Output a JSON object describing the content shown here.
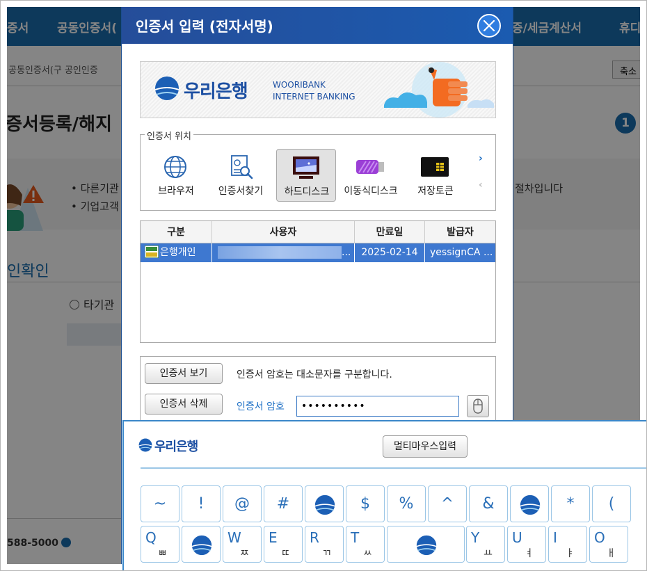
{
  "background": {
    "nav_items": [
      "증서",
      "공동인증서(",
      "증/세금계산서",
      "휴디"
    ],
    "breadcrumb": "공동인증서(구 공인인증",
    "zoom_label": "축소",
    "page_title": "증서등록/해지",
    "step_number": "1",
    "bullet_1": "• 다른기관",
    "bullet_2": "• 기업고객",
    "bullet_right": "절차입니다",
    "section_title": "인확인",
    "radio_label": "타기관",
    "phone": "588-5000"
  },
  "dialog": {
    "title": "인증서 입력 (전자서명)",
    "banner": {
      "bank_name": "우리은행",
      "eng_line1": "WOORIBANK",
      "eng_line2": "INTERNET BANKING"
    },
    "location": {
      "legend": "인증서 위치",
      "items": [
        {
          "label": "브라우저",
          "icon": "globe-icon"
        },
        {
          "label": "인증서찾기",
          "icon": "certificate-search-icon"
        },
        {
          "label": "하드디스크",
          "icon": "monitor-icon"
        },
        {
          "label": "이동식디스크",
          "icon": "usb-drive-icon"
        },
        {
          "label": "저장토큰",
          "icon": "security-token-icon"
        }
      ],
      "selected": "하드디스크",
      "next_arrow": "›",
      "prev_arrow": "‹"
    },
    "table": {
      "columns": [
        "구분",
        "사용자",
        "만료일",
        "발급자"
      ],
      "rows": [
        {
          "type": "은행개인",
          "user_suffix": "...",
          "expiry": "2025-02-14",
          "issuer": "yessignCA ..."
        }
      ]
    },
    "password": {
      "view_button": "인증서 보기",
      "delete_button": "인증서 삭제",
      "note": "인증서 암호는 대소문자를 구분합니다.",
      "label": "인증서 암호",
      "value": "••••••••••"
    }
  },
  "keyboard": {
    "bank_name": "우리은행",
    "multi_mouse_button": "멀티마우스입력",
    "row1": [
      "~",
      "!",
      "@",
      "#",
      "",
      "$",
      "%",
      "^",
      "&",
      "",
      "*",
      "("
    ],
    "row2": [
      {
        "main": "Q",
        "sub": "ㅃ"
      },
      {
        "main": "",
        "sub": ""
      },
      {
        "main": "W",
        "sub": "ㅉ"
      },
      {
        "main": "E",
        "sub": "ㄸ"
      },
      {
        "main": "R",
        "sub": "ㄲ"
      },
      {
        "main": "T",
        "sub": "ㅆ"
      },
      {
        "main": "",
        "sub": ""
      },
      {
        "main": "Y",
        "sub": "ㅛ"
      },
      {
        "main": "U",
        "sub": "ㅕ"
      },
      {
        "main": "I",
        "sub": "ㅑ"
      },
      {
        "main": "O",
        "sub": "ㅐ"
      }
    ]
  },
  "colors": {
    "brand_blue": "#1c4fa2",
    "dialog_header": "#254d99",
    "selected_row": "#3e78d0",
    "key_border": "#9bc6e6"
  }
}
